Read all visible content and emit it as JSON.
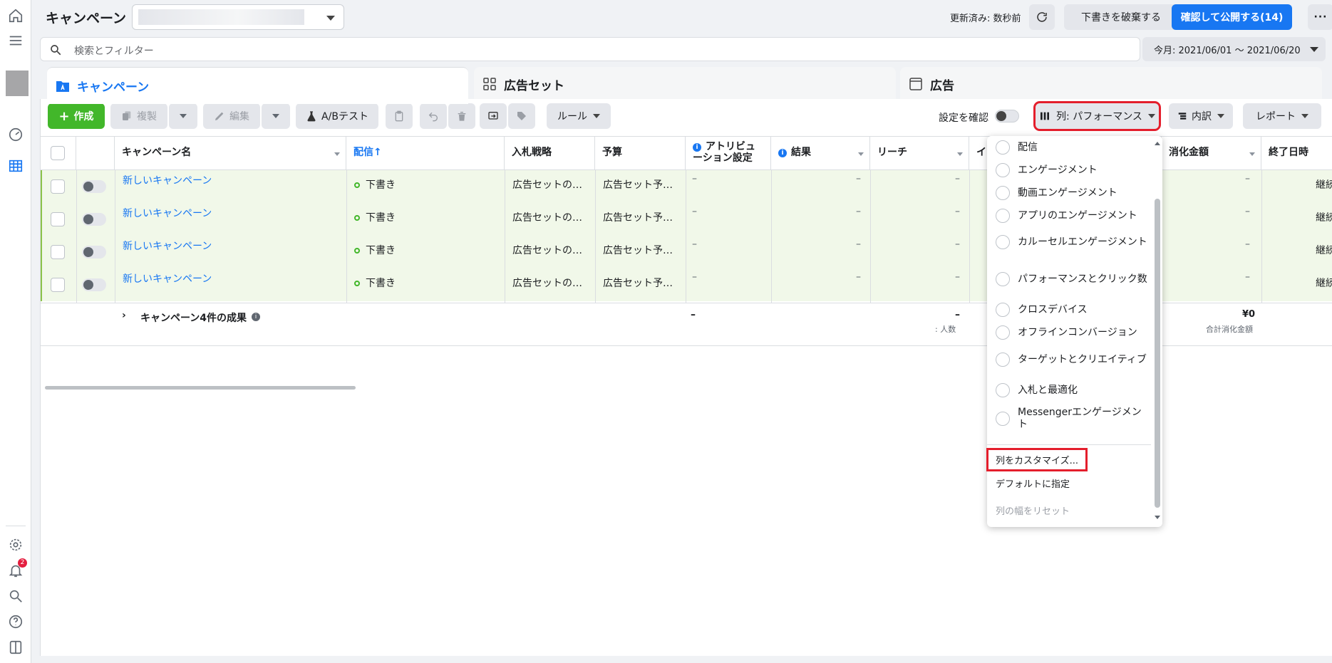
{
  "page_title": "キャンペーン",
  "header": {
    "updated": "更新済み: 数秒前",
    "discard_label": "下書きを破棄する",
    "publish_label": "確認して公開する(14)",
    "more_label": "···"
  },
  "search": {
    "placeholder": "検索とフィルター",
    "date_range": "今月: 2021/06/01 ～ 2021/06/20"
  },
  "tabs": [
    {
      "label": "キャンペーン"
    },
    {
      "label": "広告セット"
    },
    {
      "label": "広告"
    }
  ],
  "toolbar": {
    "create": "作成",
    "duplicate": "複製",
    "edit": "編集",
    "ab_test": "A/Bテスト",
    "rules": "ルール",
    "review_settings": "設定を確認",
    "columns": "列: パフォーマンス",
    "breakdown": "内訳",
    "reports": "レポート"
  },
  "columns": [
    "キャンペーン名",
    "配信↑",
    "入札戦略",
    "予算",
    "アトリビューション設定",
    "結果",
    "リーチ",
    "イ",
    "消化金額",
    "終了日時"
  ],
  "rows": [
    {
      "name": "新しいキャンペーン",
      "status": "下書き",
      "bid": "広告セットの…",
      "budget": "広告セット予…",
      "attr": "–",
      "result": "–",
      "reach": "–",
      "spent": "–",
      "end": "継続"
    },
    {
      "name": "新しいキャンペーン",
      "status": "下書き",
      "bid": "広告セットの…",
      "budget": "広告セット予…",
      "attr": "–",
      "result": "–",
      "reach": "–",
      "spent": "–",
      "end": "継続"
    },
    {
      "name": "新しいキャンペーン",
      "status": "下書き",
      "bid": "広告セットの…",
      "budget": "広告セット予…",
      "attr": "–",
      "result": "–",
      "reach": "–",
      "spent": "–",
      "end": "継続"
    },
    {
      "name": "新しいキャンペーン",
      "status": "下書き",
      "bid": "広告セットの…",
      "budget": "広告セット予…",
      "attr": "–",
      "result": "–",
      "reach": "–",
      "spent": "–",
      "end": "継続"
    }
  ],
  "summary": {
    "label": "キャンペーン4件の成果",
    "attr": "–",
    "reach": "–",
    "reach_sub": ": 人数",
    "spent": "¥0",
    "spent_sub": "合計消化金額"
  },
  "menu": {
    "items": [
      "配信",
      "エンゲージメント",
      "動画エンゲージメント",
      "アプリのエンゲージメント",
      "カルーセルエンゲージメント",
      "パフォーマンスとクリック数",
      "クロスデバイス",
      "オフラインコンバージョン",
      "ターゲットとクリエイティブ",
      "入札と最適化",
      "Messengerエンゲージメント"
    ],
    "customize": "列をカスタマイズ...",
    "set_default": "デフォルトに指定",
    "reset_width": "列の幅をリセット"
  },
  "notifications_count": "2",
  "colors": {
    "accent": "#1877f2",
    "create": "#42b72a",
    "highlight": "#e41e2c",
    "draft_row": "#f1f8e9"
  }
}
